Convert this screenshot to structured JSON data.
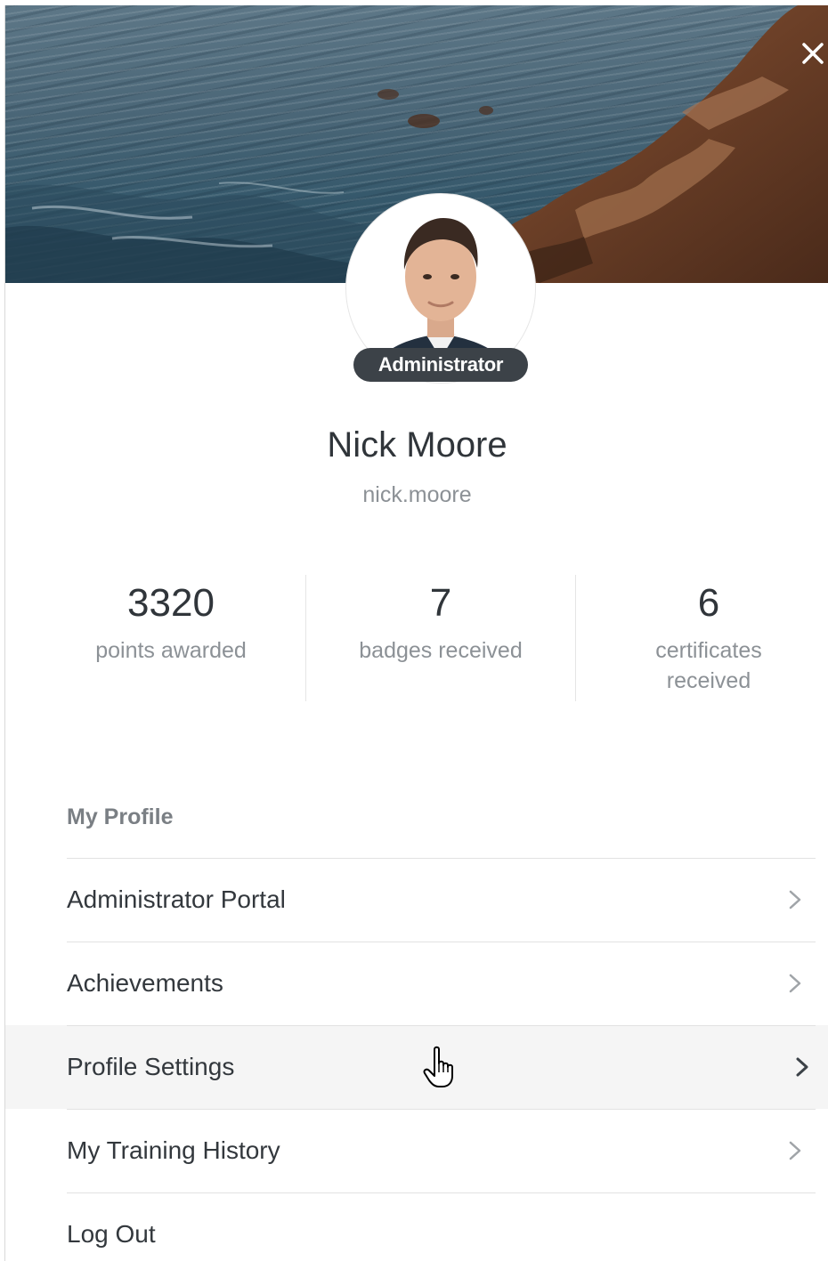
{
  "profile": {
    "role": "Administrator",
    "name": "Nick Moore",
    "username": "nick.moore"
  },
  "stats": [
    {
      "value": "3320",
      "label": "points awarded"
    },
    {
      "value": "7",
      "label": "badges received"
    },
    {
      "value": "6",
      "label": "certificates received"
    }
  ],
  "menu": {
    "section_title": "My Profile",
    "items": [
      {
        "label": "Administrator Portal",
        "icon": "chevron-right-icon"
      },
      {
        "label": "Achievements",
        "icon": "chevron-right-icon"
      },
      {
        "label": "Profile Settings",
        "icon": "chevron-right-icon"
      },
      {
        "label": "My Training History",
        "icon": "chevron-right-icon"
      },
      {
        "label": "Log Out"
      }
    ]
  },
  "icons": {
    "close": "close-icon",
    "cursor": "hand-pointer-icon"
  },
  "colors": {
    "badge_bg": "#3c4248",
    "muted_text": "#8c9196",
    "hover_row": "#f5f5f5"
  }
}
